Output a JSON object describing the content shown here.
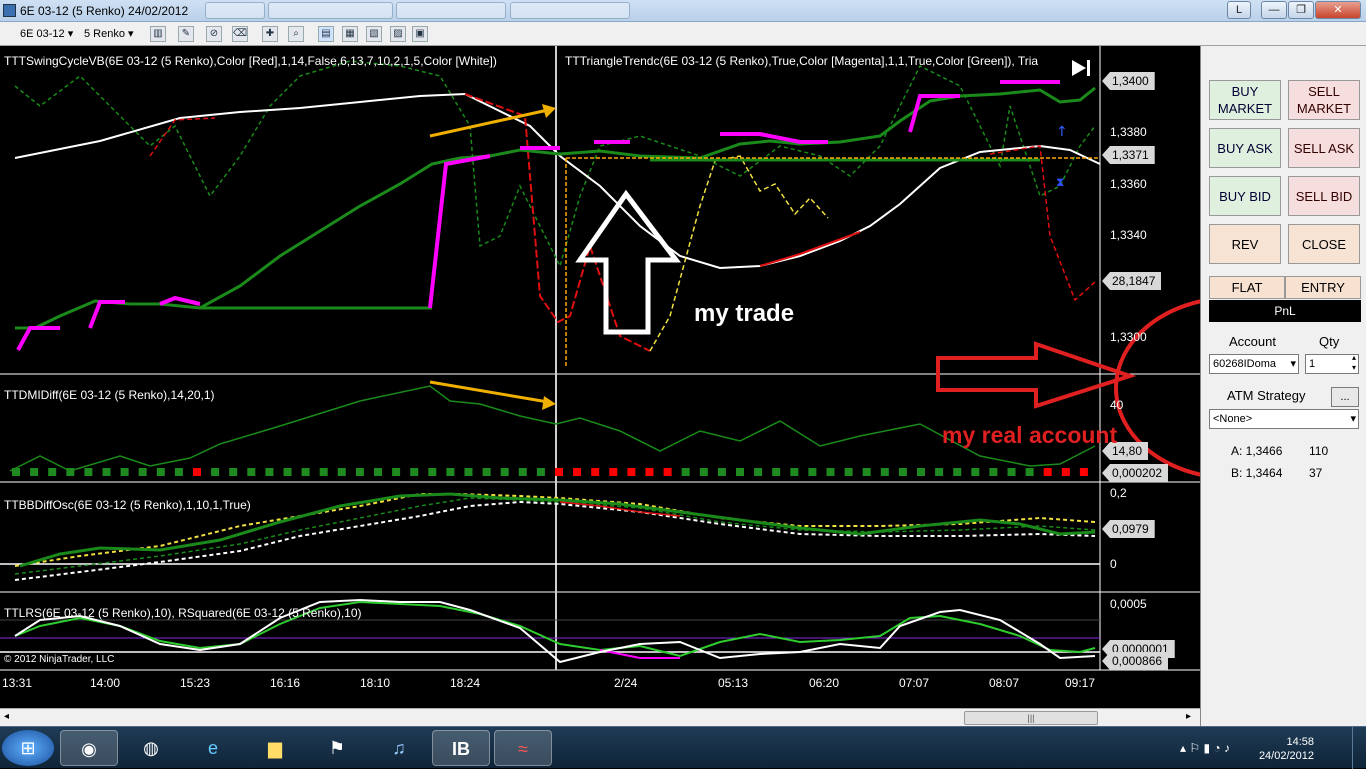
{
  "window": {
    "title": "6E 03-12 (5 Renko)  24/02/2012",
    "help_button": "L",
    "controls": {
      "minimize": "—",
      "restore": "❐",
      "close": "✕"
    }
  },
  "toolbar": {
    "instrument": "6E 03-12",
    "interval": "5 Renko"
  },
  "panels": {
    "price_label": "TTTSwingCycleVB(6E 03-12 (5 Renko),Color [Red],1,14,False,6,13,7,10,2,1,5,Color [White])",
    "triangle_label": "TTTriangleTrendc(6E 03-12  (5 Renko),True,Color [Magenta],1,1,True,Color [Green]),  Tria",
    "dmi_label": "TTDMIDiff(6E 03-12 (5 Renko),14,20,1)",
    "bbdiff_label": "TTBBDiffOsc(6E 03-12 (5 Renko),1,10,1,True)",
    "lrs_label": "TTLRS(6E 03-12 (5 Renko),10), RSquared(6E 03-12 (5 Renko),10)",
    "copyright": "© 2012 NinjaTrader, LLC"
  },
  "yaxis": {
    "price_ticks": [
      "1,3380",
      "1,3360",
      "1,3340",
      "1,3300"
    ],
    "price_box_top": "1,3400",
    "price_box_current": "1,3371",
    "price_box_mid": "28,1847",
    "dmi_tick": "40",
    "dmi_box_a": "14,80",
    "dmi_box_b": "0,000202",
    "bb_tick_top": "0,2",
    "bb_box": "0,0979",
    "bb_tick_zero": "0",
    "lrs_tick_top": "0,0005",
    "lrs_box_a": "0,0000001",
    "lrs_box_b": "0,000866"
  },
  "xaxis": [
    "13:31",
    "14:00",
    "15:23",
    "16:16",
    "18:10",
    "18:24",
    "2/24",
    "05:13",
    "06:20",
    "07:07",
    "08:07",
    "09:17"
  ],
  "annotations": {
    "my_trade": "my trade",
    "my_real_account": "my real account"
  },
  "order_panel": {
    "buy_market": "BUY MARKET",
    "sell_market": "SELL MARKET",
    "buy_ask": "BUY ASK",
    "sell_ask": "SELL ASK",
    "buy_bid": "BUY BID",
    "sell_bid": "SELL BID",
    "rev": "REV",
    "close": "CLOSE",
    "flat": "FLAT",
    "entry": "ENTRY",
    "pnl": "PnL",
    "account_label": "Account",
    "qty_label": "Qty",
    "account_value": "60268IDoma",
    "qty_value": "1",
    "atm_label": "ATM Strategy",
    "atm_value": "<None>",
    "atm_button": "...",
    "ask_label": "A: 1,3466",
    "ask_size": "110",
    "bid_label": "B: 1,3464",
    "bid_size": "37"
  },
  "taskbar": {
    "time": "14:58",
    "date": "24/02/2012"
  },
  "colors": {
    "green_trend": "#1f8a1f",
    "magenta": "#ff00ff",
    "red": "#ff0000",
    "orange": "#ffa500",
    "annot_red": "#e02020"
  }
}
